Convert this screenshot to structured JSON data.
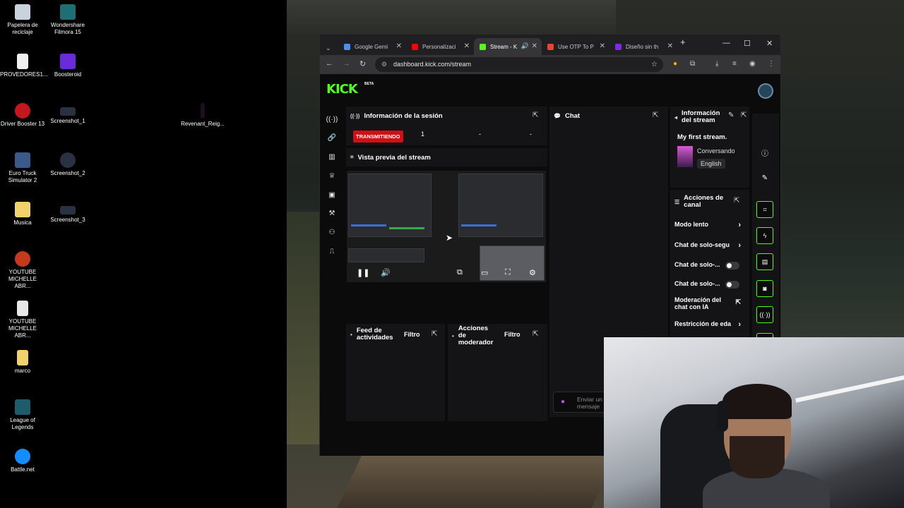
{
  "desktop": {
    "icons": [
      {
        "label": "Papelera de\nreciclaje",
        "icon": "recycle-bin-icon"
      },
      {
        "label": "Wondershare\nFilmora 15",
        "icon": "filmora-icon"
      },
      {
        "label": "PROVEDORES1...",
        "icon": "document-icon"
      },
      {
        "label": "Boosteroid",
        "icon": "boosteroid-icon"
      },
      {
        "label": "Driver Booster 13",
        "icon": "driver-booster-icon"
      },
      {
        "label": "Screenshot_1",
        "icon": "screenshot-icon"
      },
      {
        "label": "Revenant_Reig...",
        "icon": "file-icon"
      },
      {
        "label": "Euro Truck\nSimulator 2",
        "icon": "euro-truck-icon"
      },
      {
        "label": "Screenshot_2",
        "icon": "screenshot-icon"
      },
      {
        "label": "Musica",
        "icon": "folder-icon"
      },
      {
        "label": "Screenshot_3",
        "icon": "screenshot-icon"
      },
      {
        "label": "YOUTUBE\nMICHELLE ABR...",
        "icon": "youtube-file-icon"
      },
      {
        "label": "YOUTUBE\nMICHELLE ABR...",
        "icon": "video-file-icon"
      },
      {
        "label": "marco",
        "icon": "folder-icon"
      },
      {
        "label": "League of\nLegends",
        "icon": "league-icon"
      },
      {
        "label": "Battle.net",
        "icon": "battlenet-icon"
      }
    ]
  },
  "browser": {
    "tabs": [
      {
        "title": "Google Gemi",
        "favicon_color": "#4f8df5"
      },
      {
        "title": "Personalizaci",
        "favicon_color": "#ff0000"
      },
      {
        "title": "Stream - K",
        "favicon_color": "#53fc18"
      },
      {
        "title": "Use OTP To P",
        "favicon_color": "#ea4335"
      },
      {
        "title": "Diseño sin th",
        "favicon_color": "#7d2ae8"
      }
    ],
    "new_tab": "+",
    "url": "dashboard.kick.com/stream",
    "window_controls": {
      "minimize": "—",
      "maximize": "☐",
      "close": "✕"
    }
  },
  "kick": {
    "logo": "KICK",
    "beta": "BETA",
    "brand_color": "#53fc18",
    "session": {
      "title": "Información de la sesión",
      "status": "TRANSMITIENDO",
      "viewers": "1",
      "val2": "-",
      "val3": "-"
    },
    "preview": {
      "title": "Vista previa del stream"
    },
    "chat": {
      "title": "Chat",
      "input_placeholder": "Enviar un mensaje"
    },
    "stream_info": {
      "title": "Información del stream",
      "stream_title": "My first stream.",
      "category": "Conversando",
      "language": "English"
    },
    "channel_actions": {
      "title": "Acciones de canal",
      "items": [
        {
          "label": "Modo lento",
          "control": "chevron"
        },
        {
          "label": "Chat de solo-segu",
          "control": "chevron"
        },
        {
          "label": "Chat de solo-...",
          "control": "toggle"
        },
        {
          "label": "Chat de solo-...",
          "control": "toggle"
        },
        {
          "label": "Moderación del chat con IA",
          "control": "external"
        },
        {
          "label": "Restricción de eda",
          "control": "chevron"
        }
      ]
    },
    "activity_feed": {
      "title": "Feed de actividades",
      "filter": "Filtro"
    },
    "mod_actions": {
      "title": "Acciones de moderador",
      "filter": "Filtro"
    }
  }
}
